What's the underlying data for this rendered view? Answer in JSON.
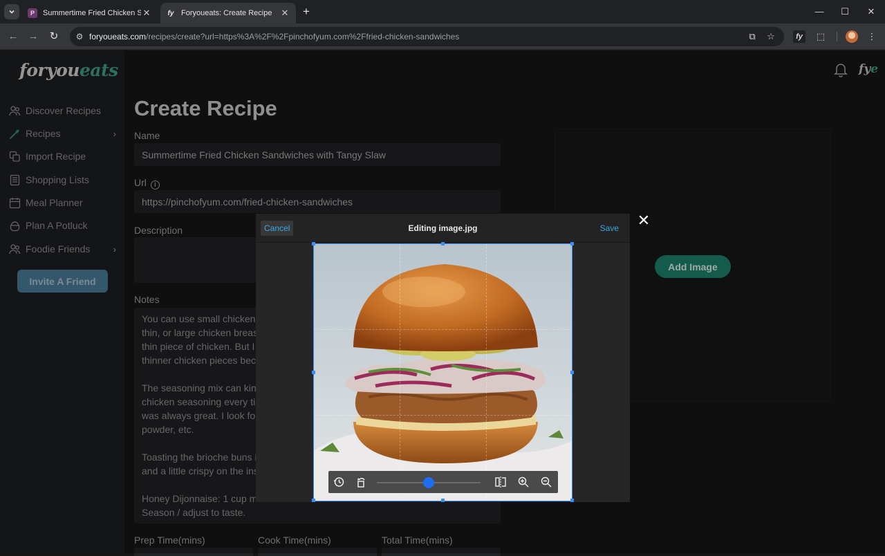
{
  "browser": {
    "tabs": [
      {
        "title": "Summertime Fried Chicken San",
        "active": false
      },
      {
        "title": "Foryoueats: Create Recipe",
        "active": true
      }
    ],
    "url_host": "foryoueats.com",
    "url_path": "/recipes/create?url=https%3A%2F%2Fpinchofyum.com%2Ffried-chicken-sandwiches"
  },
  "app": {
    "logo_for": "foryou",
    "logo_eats": "eats",
    "header_logo_fy": "fy",
    "header_logo_e": "e"
  },
  "sidebar": {
    "items": [
      {
        "label": "Discover Recipes",
        "icon": "people-icon"
      },
      {
        "label": "Recipes",
        "icon": "spoon-icon",
        "has_submenu": true
      },
      {
        "label": "Import Recipe",
        "icon": "copy-icon"
      },
      {
        "label": "Shopping Lists",
        "icon": "list-icon"
      },
      {
        "label": "Meal Planner",
        "icon": "calendar-icon"
      },
      {
        "label": "Plan A Potluck",
        "icon": "pot-icon"
      },
      {
        "label": "Foodie Friends",
        "icon": "friends-icon",
        "has_submenu": true
      }
    ],
    "invite_label": "Invite A Friend"
  },
  "form": {
    "title": "Create Recipe",
    "name_label": "Name",
    "name_value": "Summertime Fried Chicken Sandwiches with Tangy Slaw",
    "url_label": "Url",
    "url_value": "https://pinchofyum.com/fried-chicken-sandwiches",
    "description_label": "Description",
    "notes_label": "Notes",
    "notes_value": "You can use small chicken\nthin, or large chicken breas\nthin piece of chicken. But I\nthinner chicken pieces beca\n\nThe seasoning mix can kind\nchicken seasoning every ti\nwas always great. I look fo\npowder, etc.\n\nToasting the brioche buns i\nand a little crispy on the ins\n\nHoney Dijonnaise: 1 cup ma\nSeason / adjust to taste.",
    "prep_label": "Prep Time(mins)",
    "cook_label": "Cook Time(mins)",
    "total_label": "Total Time(mins)",
    "add_image_label": "Add Image"
  },
  "editor": {
    "cancel_label": "Cancel",
    "title": "Editing image.jpg",
    "save_label": "Save",
    "zoom_level": 0.5
  },
  "colors": {
    "accent_teal": "#1e7f6a",
    "accent_blue": "#3d8bf5",
    "link_blue": "#3aa7e8"
  }
}
